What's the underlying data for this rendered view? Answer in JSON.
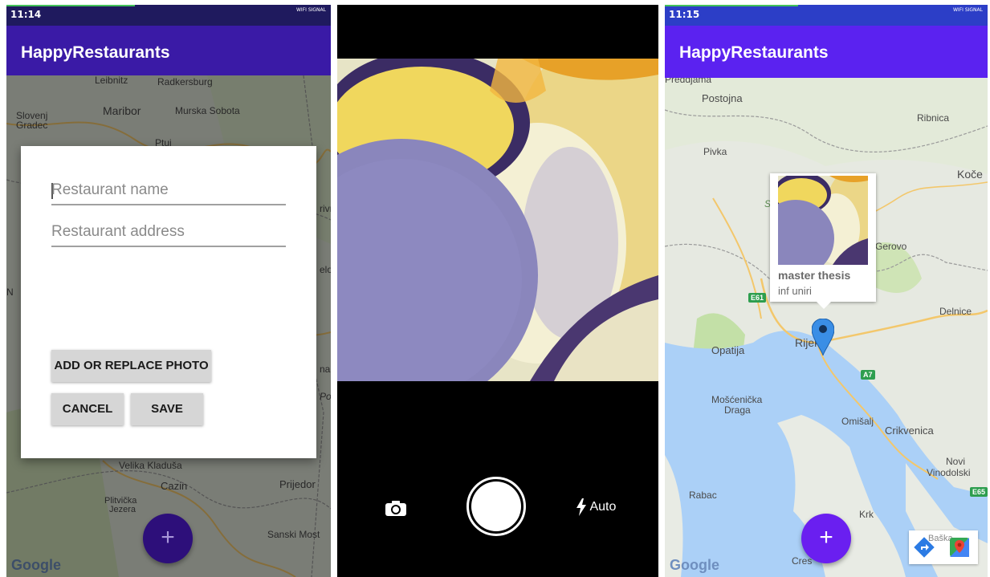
{
  "screen1": {
    "time": "11:14",
    "signal": "WIFI SIGNAL",
    "app_title": "HappyRestaurants",
    "fields": {
      "name_placeholder": "Restaurant name",
      "address_placeholder": "Restaurant address"
    },
    "buttons": {
      "add_photo": "ADD OR REPLACE PHOTO",
      "cancel": "CANCEL",
      "save": "SAVE"
    },
    "map_labels": [
      "Leibnitz",
      "Radkersburg",
      "Slovenj",
      "Gradec",
      "Maribor",
      "Murska Sobota",
      "Ptuj",
      "Velika Kladuša",
      "Cazin",
      "Prijedor",
      "Plitvička",
      "Jezera",
      "Sanski Most",
      "rivn",
      "elov",
      "na.",
      "Po",
      "N"
    ],
    "google_logo": "Google",
    "fab_icon": "+",
    "colors": {
      "appbar": "#3a1aa6",
      "statusbar": "#1f1a5e",
      "fab": "#4b19c9"
    }
  },
  "screen2": {
    "switch_camera_icon": "camera-switch-icon",
    "flash_icon": "flash-icon",
    "flash_label": "Auto"
  },
  "screen3": {
    "time": "11:15",
    "signal": "WIFI SIGNAL",
    "app_title": "HappyRestaurants",
    "info_window": {
      "title": "master thesis",
      "snippet": "inf uniri"
    },
    "map_labels": [
      "Postojna",
      "Ribnica",
      "Pivka",
      "Koče",
      "Gerovo",
      "Delnice",
      "Opatija",
      "Rijeka",
      "Mošćenička",
      "Draga",
      "Omišalj",
      "Crikvenica",
      "Novi",
      "Vinodolski",
      "Rabac",
      "Krk",
      "Cres",
      "Preddjama",
      "S",
      "Baška"
    ],
    "road_shields": [
      "E61",
      "A7",
      "E65"
    ],
    "google_logo": "Google",
    "fab_icon": "+",
    "map_tools": [
      "directions-icon",
      "google-maps-icon"
    ],
    "colors": {
      "appbar": "#5b22f0",
      "statusbar": "#2c3ec7",
      "fab": "#6a1ff0",
      "marker": "#3a8ee6"
    }
  }
}
